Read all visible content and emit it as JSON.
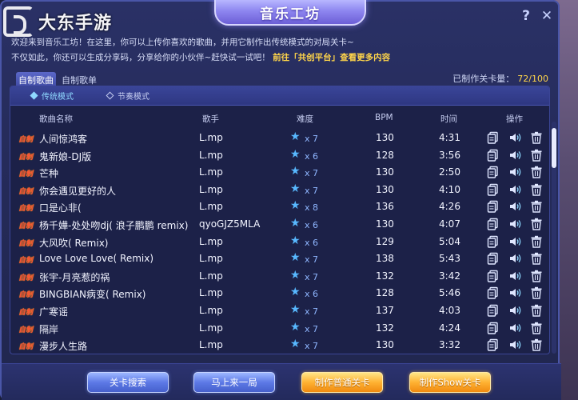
{
  "watermark": {
    "text": "大东手游"
  },
  "window": {
    "title": "音乐工坊"
  },
  "top_icons": {
    "help": "?",
    "close": "✕"
  },
  "intro": {
    "line1": "欢迎来到音乐工坊！在这里，你可以上传你喜欢的歌曲，并用它制作出传统模式的对局关卡~",
    "line2": "不仅如此，你还可以生成分享码，分享给你的小伙伴~赶快试一试吧！",
    "link": "前往「共创平台」查看更多内容"
  },
  "tabs": [
    {
      "label": "自制歌曲",
      "active": true
    },
    {
      "label": "自制歌单",
      "active": false
    }
  ],
  "level_count": {
    "label": "已制作关卡量：",
    "value": "72/100"
  },
  "modes": [
    {
      "label": "传统模式",
      "active": true
    },
    {
      "label": "节奏模式",
      "active": false
    }
  ],
  "columns": {
    "name": "歌曲名称",
    "singer": "歌手",
    "difficulty": "难度",
    "bpm": "BPM",
    "time": "时间",
    "ops": "操作"
  },
  "badge_text": "自制",
  "rows": [
    {
      "name": "人间惊鸿客",
      "singer": "L.mp",
      "diff": "x 7",
      "bpm": "130",
      "time": "4:31"
    },
    {
      "name": "鬼新娘-DJ版",
      "singer": "L.mp",
      "diff": "x 6",
      "bpm": "128",
      "time": "3:56"
    },
    {
      "name": "芒种",
      "singer": "L.mp",
      "diff": "x 7",
      "bpm": "130",
      "time": "2:50"
    },
    {
      "name": "你会遇见更好的人",
      "singer": "L.mp",
      "diff": "x 7",
      "bpm": "130",
      "time": "4:10"
    },
    {
      "name": "口是心非(",
      "singer": "L.mp",
      "diff": "x 8",
      "bpm": "136",
      "time": "4:26"
    },
    {
      "name": "杨千嬅-处处吻dj( 浪子鹏鹏 remix)",
      "singer": "qyoGJZ5MLA",
      "diff": "x 6",
      "bpm": "130",
      "time": "4:07"
    },
    {
      "name": "大风吹( Remix)",
      "singer": "L.mp",
      "diff": "x 6",
      "bpm": "129",
      "time": "5:04"
    },
    {
      "name": "Love Love Love( Remix)",
      "singer": "L.mp",
      "diff": "x 7",
      "bpm": "138",
      "time": "5:43"
    },
    {
      "name": "张宇-月亮惹的祸",
      "singer": "L.mp",
      "diff": "x 7",
      "bpm": "132",
      "time": "3:42"
    },
    {
      "name": "BINGBIAN病变( Remix)",
      "singer": "L.mp",
      "diff": "x 6",
      "bpm": "128",
      "time": "5:46"
    },
    {
      "name": "广寒谣",
      "singer": "L.mp",
      "diff": "x 7",
      "bpm": "137",
      "time": "4:03"
    },
    {
      "name": "隔岸",
      "singer": "L.mp",
      "diff": "x 7",
      "bpm": "132",
      "time": "4:24"
    },
    {
      "name": "漫步人生路",
      "singer": "L.mp",
      "diff": "x 7",
      "bpm": "130",
      "time": "3:32"
    }
  ],
  "buttons": {
    "search": "关卡搜索",
    "quick_match": "马上来一局",
    "make_normal": "制作普通关卡",
    "make_show": "制作Show关卡"
  },
  "icons": {
    "copy": "copy-icon",
    "play": "speaker-icon",
    "delete": "trash-icon",
    "star": "star-icon"
  },
  "colors": {
    "accent_gold": "#ffd54a",
    "badge_red": "#ff4a3a",
    "active_mode": "#8fd8ff"
  }
}
